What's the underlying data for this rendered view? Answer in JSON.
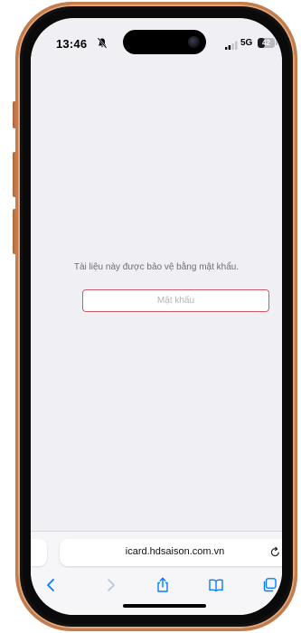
{
  "status_bar": {
    "time": "13:46",
    "network": "5G",
    "battery_level": "42",
    "battery_fraction": 0.42
  },
  "page": {
    "message": "Tài liệu này được bảo vệ bằng mật khẩu.",
    "password_placeholder": "Mật khẩu",
    "password_value": ""
  },
  "browser": {
    "url": "icard.hdsaison.com.vn"
  },
  "icons": {
    "silent": "bell-slash-icon",
    "signal": "cell-signal-icon",
    "reload": "reload-icon",
    "back": "chevron-left-icon",
    "forward": "chevron-right-icon",
    "share": "share-icon",
    "bookmarks": "book-icon",
    "tabs": "tabs-icon"
  },
  "colors": {
    "accent": "#0a7aff",
    "input_border": "#d05a6a",
    "frame": "#c57c4d"
  }
}
